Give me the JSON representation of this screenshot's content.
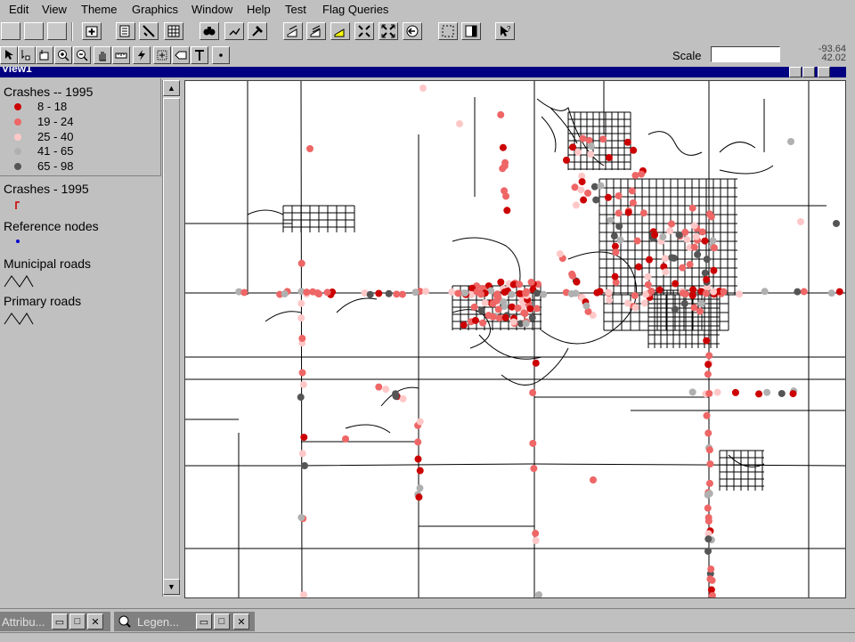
{
  "menu": [
    "Edit",
    "View",
    "Theme",
    "Graphics",
    "Window",
    "Help",
    "Test",
    "Flag Queries"
  ],
  "window": {
    "title": "View1"
  },
  "scale": {
    "label": "Scale",
    "value": ""
  },
  "coords": {
    "x": "-93.64",
    "y": "42.02"
  },
  "legend": {
    "crash_classes_title": "Crashes -- 1995",
    "crash_classes": [
      {
        "label": "8 - 18",
        "color": "#cc0000"
      },
      {
        "label": "19 - 24",
        "color": "#ee6666"
      },
      {
        "label": "25 - 40",
        "color": "#ffc8c8"
      },
      {
        "label": "41 - 65",
        "color": "#b0b0b0"
      },
      {
        "label": "65 - 98",
        "color": "#555555"
      }
    ],
    "crashes_title": "Crashes - 1995",
    "crashes_symbol_color": "#cc0000",
    "ref_nodes_title": "Reference nodes",
    "ref_nodes_color": "#0000cc",
    "municipal_roads_title": "Municipal roads",
    "primary_roads_title": "Primary roads"
  },
  "tasks": [
    {
      "label": "Attribu...",
      "icon": "table-icon"
    },
    {
      "label": "Legen...",
      "icon": "legend-icon"
    }
  ],
  "icons": {
    "toolbar1": [
      "new-icon",
      "open-icon",
      "save-icon",
      "add-theme-icon",
      "theme-properties-icon",
      "edit-legend-icon",
      "open-table-icon",
      "find-icon",
      "query-icon",
      "hammer-icon",
      "zoom-full-icon",
      "zoom-active-icon",
      "zoom-selected-icon",
      "zoom-in-fixed-icon",
      "zoom-out-fixed-icon",
      "zoom-previous-icon",
      "select-features-icon",
      "clear-selection-icon",
      "help-icon"
    ],
    "toolbar2": [
      "pointer-icon",
      "vertex-edit-icon",
      "select-feature-icon",
      "zoom-in-icon",
      "zoom-out-icon",
      "pan-icon",
      "measure-icon",
      "hotlink-icon",
      "area-of-interest-icon",
      "label-icon",
      "text-icon",
      "draw-point-icon"
    ]
  }
}
